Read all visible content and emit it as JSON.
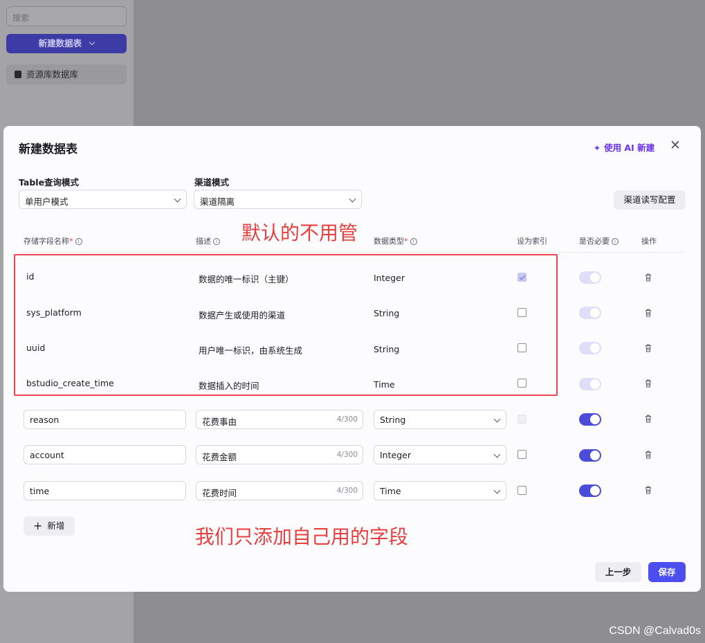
{
  "background": {
    "search_placeholder": "搜索",
    "new_table_button": "新建数据表",
    "database_item": "资源库数据库",
    "watermark": "CSDN @Calvad0s"
  },
  "modal": {
    "title": "新建数据表",
    "ai_button": "使用 AI 新建",
    "query_mode": {
      "label": "Table查询模式",
      "value": "单用户模式"
    },
    "channel_mode": {
      "label": "渠道模式",
      "value": "渠道隔离"
    },
    "rw_config_button": "渠道读写配置",
    "columns": {
      "field_name": "存储字段名称",
      "description": "描述",
      "data_type": "数据类型",
      "index": "设为索引",
      "required": "是否必要",
      "actions": "操作"
    },
    "system_fields": [
      {
        "name": "id",
        "description": "数据的唯一标识（主键）",
        "type": "Integer",
        "indexed": true
      },
      {
        "name": "sys_platform",
        "description": "数据产生或使用的渠道",
        "type": "String",
        "indexed": false
      },
      {
        "name": "uuid",
        "description": "用户唯一标识，由系统生成",
        "type": "String",
        "indexed": false
      },
      {
        "name": "bstudio_create_time",
        "description": "数据插入的时间",
        "type": "Time",
        "indexed": false
      }
    ],
    "user_fields": [
      {
        "name": "reason",
        "description": "花费事由",
        "counter": "4/300",
        "type": "String",
        "index_disabled": true,
        "required": true
      },
      {
        "name": "account",
        "description": "花费金额",
        "counter": "4/300",
        "type": "Integer",
        "index_disabled": false,
        "required": true
      },
      {
        "name": "time",
        "description": "花费时间",
        "counter": "4/300",
        "type": "Time",
        "index_disabled": false,
        "required": true
      }
    ],
    "add_button": "新增",
    "prev_button": "上一步",
    "save_button": "保存"
  },
  "annotations": {
    "top": "默认的不用管",
    "bottom": "我们只添加自己用的字段",
    "color": "#e83e3e"
  }
}
